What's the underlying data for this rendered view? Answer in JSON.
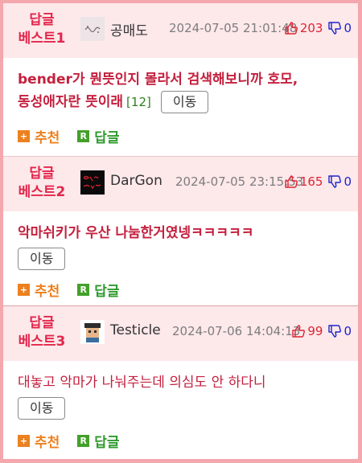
{
  "colors": {
    "page_border": "#f4a7ad",
    "header_bg": "#fde8ea",
    "best_label": "#e3264b",
    "comment_text": "#c4203e",
    "upvote": "#dd2433",
    "downvote": "#1d24c9",
    "recommend": "#ec8120",
    "reply": "#2f9a2e"
  },
  "replies": [
    {
      "best_line1": "답글",
      "best_line2": "베스트1",
      "avatar_icon": "gongmaedo-avatar-icon",
      "author": "공매도",
      "date": "2024-07-05 21:01:48",
      "up_count": "203",
      "down_count": "0",
      "comment": "bender가 뭔뜻인지 몰라서 검색해보니까 호모, 동성애자란 뜻이래",
      "reply_count": "[12]",
      "move_label": "이동",
      "recommend_box": "+",
      "recommend_label": "추천",
      "reply_box": "R",
      "reply_label": "답글"
    },
    {
      "best_line1": "답글",
      "best_line2": "베스트2",
      "avatar_icon": "dargon-avatar-icon",
      "author": "DarGon",
      "date": "2024-07-05 23:15:53",
      "up_count": "165",
      "down_count": "0",
      "comment": "악마쉬키가 우산 나눔한거였넹ㅋㅋㅋㅋㅋ",
      "move_label": "이동",
      "recommend_box": "+",
      "recommend_label": "추천",
      "reply_box": "R",
      "reply_label": "답글"
    },
    {
      "best_line1": "답글",
      "best_line2": "베스트3",
      "avatar_icon": "testicle-avatar-icon",
      "author": "Testicle",
      "date": "2024-07-06 14:04:13",
      "up_count": "99",
      "down_count": "0",
      "comment": "대놓고 악마가 나눠주는데 의심도 안 하다니",
      "move_label": "이동",
      "recommend_box": "+",
      "recommend_label": "추천",
      "reply_box": "R",
      "reply_label": "답글"
    }
  ]
}
